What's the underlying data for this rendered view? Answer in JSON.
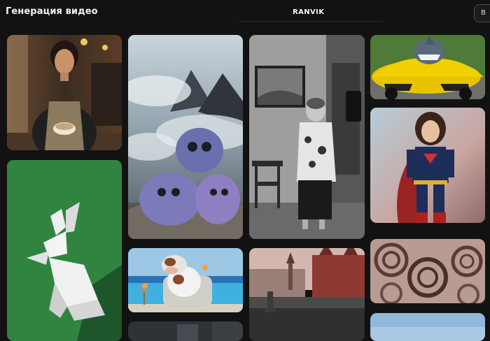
{
  "header": {
    "title": "Генерация видео",
    "brand": "RANVIK",
    "cut_button_label": "В"
  },
  "gallery": {
    "items": [
      {
        "subject": "barista-holding-latte"
      },
      {
        "subject": "origami-rabbit-on-green"
      },
      {
        "subject": "fluffy-purple-monsters-in-clouds"
      },
      {
        "subject": "cow-lounging-by-pool"
      },
      {
        "subject": "dark-landscape-partial"
      },
      {
        "subject": "woman-on-vintage-telephone"
      },
      {
        "subject": "crowd-at-red-square"
      },
      {
        "subject": "shark-driving-yellow-sports-car"
      },
      {
        "subject": "woman-in-superhero-costume"
      },
      {
        "subject": "fractal-spiral-pattern"
      },
      {
        "subject": "blue-sky-partial"
      }
    ]
  }
}
